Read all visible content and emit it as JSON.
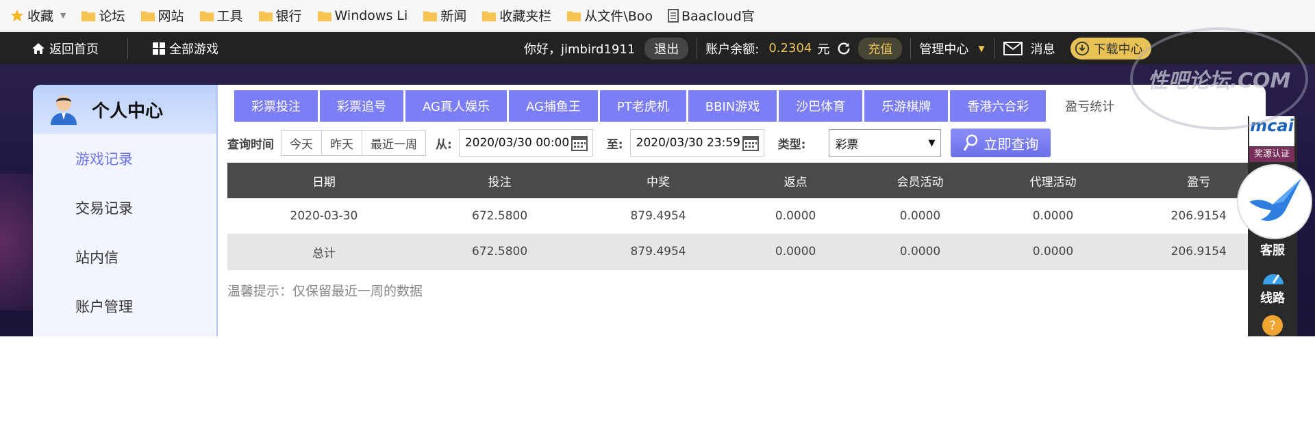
{
  "bookmarks": [
    {
      "label": "收藏",
      "icon": "star-icon"
    },
    {
      "label": "论坛",
      "icon": "folder-icon"
    },
    {
      "label": "网站",
      "icon": "folder-icon"
    },
    {
      "label": "工具",
      "icon": "folder-icon"
    },
    {
      "label": "银行",
      "icon": "folder-icon"
    },
    {
      "label": "Windows Li",
      "icon": "folder-icon"
    },
    {
      "label": "新闻",
      "icon": "folder-icon"
    },
    {
      "label": "收藏夹栏",
      "icon": "folder-icon"
    },
    {
      "label": "从文件\\Boo",
      "icon": "folder-icon"
    },
    {
      "label": "Baacloud官",
      "icon": "page-icon"
    }
  ],
  "topbar": {
    "home": "返回首页",
    "all_games": "全部游戏",
    "greeting": "你好，jimbird1911",
    "logout": "退出",
    "balance_label": "账户余额:",
    "balance_value": "0.2304",
    "balance_unit": "元",
    "recharge": "充值",
    "admin": "管理中心",
    "messages": "消息",
    "download": "下载中心"
  },
  "sidebar": {
    "title": "个人中心",
    "items": [
      {
        "label": "游戏记录",
        "active": true
      },
      {
        "label": "交易记录",
        "active": false
      },
      {
        "label": "站内信",
        "active": false
      },
      {
        "label": "账户管理",
        "active": false
      }
    ]
  },
  "tabs": [
    {
      "label": "彩票投注"
    },
    {
      "label": "彩票追号"
    },
    {
      "label": "AG真人娱乐"
    },
    {
      "label": "AG捕鱼王"
    },
    {
      "label": "PT老虎机"
    },
    {
      "label": "BBIN游戏"
    },
    {
      "label": "沙巴体育"
    },
    {
      "label": "乐游棋牌"
    },
    {
      "label": "香港六合彩"
    },
    {
      "label": "盈亏统计"
    }
  ],
  "query": {
    "time_label": "查询时间",
    "today": "今天",
    "yesterday": "昨天",
    "last_week": "最近一周",
    "from_label": "从:",
    "from_value": "2020/03/30 00:00",
    "to_label": "至:",
    "to_value": "2020/03/30 23:59",
    "type_label": "类型:",
    "type_value": "彩票",
    "search_button": "立即查询"
  },
  "table": {
    "headers": [
      "日期",
      "投注",
      "中奖",
      "返点",
      "会员活动",
      "代理活动",
      "盈亏"
    ],
    "rows": [
      [
        "2020-03-30",
        "672.5800",
        "879.4954",
        "0.0000",
        "0.0000",
        "0.0000",
        "206.9154"
      ]
    ],
    "total": [
      "总计",
      "672.5800",
      "879.4954",
      "0.0000",
      "0.0000",
      "0.0000",
      "206.9154"
    ]
  },
  "tip": "温馨提示：仅保留最近一周的数据",
  "rightbar": {
    "logo": "mcai",
    "cert": "奖源认证",
    "service": "客服",
    "route": "线路"
  },
  "watermark": "性吧论坛.COM",
  "colors": {
    "accent": "#7b7ef5",
    "gold": "#e8c254",
    "topbar": "#222222",
    "banner": "#1e1742"
  }
}
